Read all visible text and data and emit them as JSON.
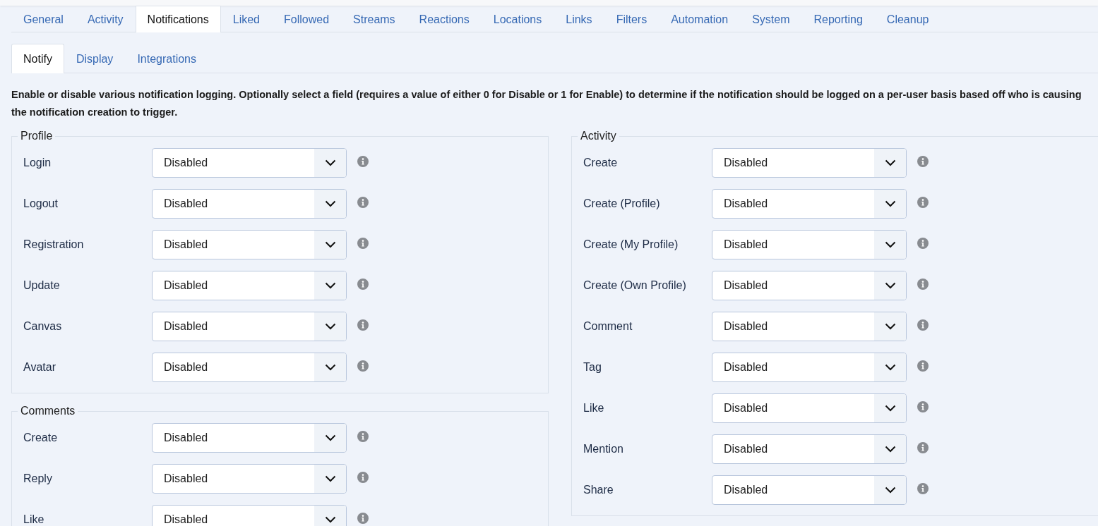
{
  "tabs": [
    {
      "label": "General",
      "selected": false
    },
    {
      "label": "Activity",
      "selected": false
    },
    {
      "label": "Notifications",
      "selected": true
    },
    {
      "label": "Liked",
      "selected": false
    },
    {
      "label": "Followed",
      "selected": false
    },
    {
      "label": "Streams",
      "selected": false
    },
    {
      "label": "Reactions",
      "selected": false
    },
    {
      "label": "Locations",
      "selected": false
    },
    {
      "label": "Links",
      "selected": false
    },
    {
      "label": "Filters",
      "selected": false
    },
    {
      "label": "Automation",
      "selected": false
    },
    {
      "label": "System",
      "selected": false
    },
    {
      "label": "Reporting",
      "selected": false
    },
    {
      "label": "Cleanup",
      "selected": false
    }
  ],
  "subtabs": [
    {
      "label": "Notify",
      "selected": true
    },
    {
      "label": "Display",
      "selected": false
    },
    {
      "label": "Integrations",
      "selected": false
    }
  ],
  "description": "Enable or disable various notification logging. Optionally select a field (requires a value of either 0 for Disable or 1 for Enable) to determine if the notification should be logged on a per-user basis based off who is causing the notification creation to trigger.",
  "columns": [
    [
      {
        "title": "Profile",
        "settings": [
          {
            "label": "Login",
            "value": "Disabled"
          },
          {
            "label": "Logout",
            "value": "Disabled"
          },
          {
            "label": "Registration",
            "value": "Disabled"
          },
          {
            "label": "Update",
            "value": "Disabled"
          },
          {
            "label": "Canvas",
            "value": "Disabled"
          },
          {
            "label": "Avatar",
            "value": "Disabled"
          }
        ]
      },
      {
        "title": "Comments",
        "settings": [
          {
            "label": "Create",
            "value": "Disabled"
          },
          {
            "label": "Reply",
            "value": "Disabled"
          },
          {
            "label": "Like",
            "value": "Disabled"
          }
        ]
      }
    ],
    [
      {
        "title": "Activity",
        "settings": [
          {
            "label": "Create",
            "value": "Disabled"
          },
          {
            "label": "Create (Profile)",
            "value": "Disabled"
          },
          {
            "label": "Create (My Profile)",
            "value": "Disabled"
          },
          {
            "label": "Create (Own Profile)",
            "value": "Disabled"
          },
          {
            "label": "Comment",
            "value": "Disabled"
          },
          {
            "label": "Tag",
            "value": "Disabled"
          },
          {
            "label": "Like",
            "value": "Disabled"
          },
          {
            "label": "Mention",
            "value": "Disabled"
          },
          {
            "label": "Share",
            "value": "Disabled"
          }
        ]
      }
    ]
  ]
}
